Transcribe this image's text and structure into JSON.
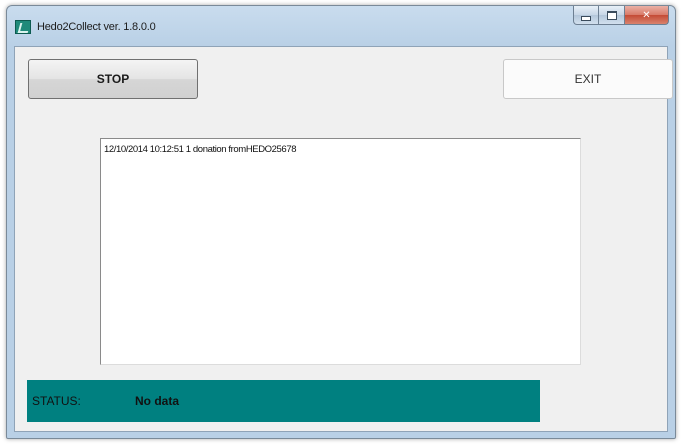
{
  "window": {
    "title": "Hedo2Collect ver. 1.8.0.0",
    "controls": {
      "minimize_icon": "minimize-icon",
      "maximize_icon": "maximize-icon",
      "close_glyph": "✕"
    }
  },
  "toolbar": {
    "stop_label": "STOP",
    "exit_label": "EXIT"
  },
  "log": {
    "lines": [
      "12/10/2014 10:12:51 1 donation fromHEDO25678"
    ]
  },
  "status": {
    "label": "STATUS:",
    "value": "No data",
    "background_color": "#008080"
  }
}
